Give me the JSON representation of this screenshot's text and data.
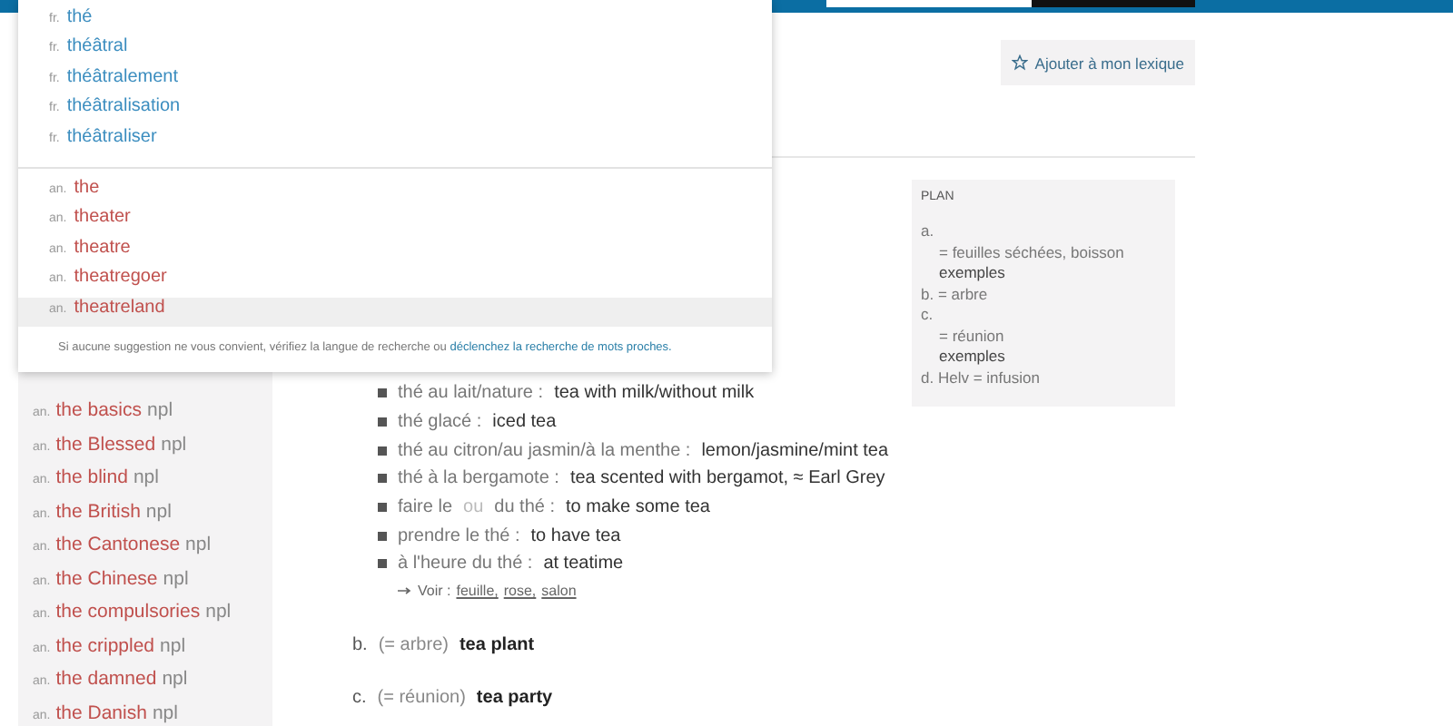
{
  "suggestions": {
    "groups": [
      {
        "kind": "fr",
        "items": [
          {
            "lang": "fr.",
            "word": "thé",
            "selected": false
          },
          {
            "lang": "fr.",
            "word": "théâtral",
            "selected": false
          },
          {
            "lang": "fr.",
            "word": "théâtralement",
            "selected": false
          },
          {
            "lang": "fr.",
            "word": "théâtralisation",
            "selected": false
          },
          {
            "lang": "fr.",
            "word": "théâtraliser",
            "selected": false
          }
        ]
      },
      {
        "kind": "en",
        "items": [
          {
            "lang": "an.",
            "word": "the",
            "selected": false
          },
          {
            "lang": "an.",
            "word": "theater",
            "selected": false
          },
          {
            "lang": "an.",
            "word": "theatre",
            "selected": false
          },
          {
            "lang": "an.",
            "word": "theatregoer",
            "selected": false
          },
          {
            "lang": "an.",
            "word": "theatreland",
            "selected": true
          }
        ]
      }
    ],
    "footer": {
      "text": "Si aucune suggestion ne vous convient, vérifiez la langue de recherche ou",
      "link": "déclenchez la recherche de mots proches."
    }
  },
  "lexicon_button": "Ajouter à mon lexique",
  "sidebar": {
    "items": [
      {
        "lang": "an.",
        "word": "the basics",
        "pos": "npl"
      },
      {
        "lang": "an.",
        "word": "the Blessed",
        "pos": "npl"
      },
      {
        "lang": "an.",
        "word": "the blind",
        "pos": "npl"
      },
      {
        "lang": "an.",
        "word": "the British",
        "pos": "npl"
      },
      {
        "lang": "an.",
        "word": "the Cantonese",
        "pos": "npl"
      },
      {
        "lang": "an.",
        "word": "the Chinese",
        "pos": "npl"
      },
      {
        "lang": "an.",
        "word": "the compulsories",
        "pos": "npl"
      },
      {
        "lang": "an.",
        "word": "the crippled",
        "pos": "npl"
      },
      {
        "lang": "an.",
        "word": "the damned",
        "pos": "npl"
      },
      {
        "lang": "an.",
        "word": "the Danish",
        "pos": "npl"
      }
    ]
  },
  "entry": {
    "examples": [
      {
        "fr": [
          {
            "kind": "phrase",
            "text": "thé au lait/nature :"
          }
        ],
        "en": "tea with milk/without milk"
      },
      {
        "fr": [
          {
            "kind": "phrase",
            "text": "thé glacé :"
          }
        ],
        "en": "iced tea"
      },
      {
        "fr": [
          {
            "kind": "phrase",
            "text": "thé au citron/au jasmin/à la menthe :"
          }
        ],
        "en": "lemon/jasmine/mint tea"
      },
      {
        "fr": [
          {
            "kind": "phrase",
            "text": "thé à la bergamote :"
          }
        ],
        "en": "tea scented with bergamot, ≈ Earl Grey"
      },
      {
        "fr": [
          {
            "kind": "phrase",
            "text": "faire le"
          },
          {
            "kind": "connector",
            "text": "ou"
          },
          {
            "kind": "phrase",
            "text": "du thé :"
          }
        ],
        "en": "to make some tea"
      },
      {
        "fr": [
          {
            "kind": "phrase",
            "text": "prendre le thé :"
          }
        ],
        "en": "to have tea"
      },
      {
        "fr": [
          {
            "kind": "phrase",
            "text": "à l'heure du thé :"
          }
        ],
        "en": "at teatime"
      }
    ],
    "see_also": {
      "label": "Voir :",
      "links": [
        "feuille,",
        "rose,",
        "salon"
      ]
    },
    "senses": [
      {
        "letter": "b.",
        "gloss": "(= arbre)",
        "translation": "tea plant"
      },
      {
        "letter": "c.",
        "gloss": "(= réunion)",
        "translation": "tea party"
      }
    ]
  },
  "plan": {
    "title": "PLAN",
    "items": [
      {
        "text": "a.",
        "kind": "label",
        "children": [
          {
            "text": "= feuilles séchées, boisson",
            "kind": "gloss"
          },
          {
            "text": "exemples",
            "kind": "examples"
          }
        ]
      },
      {
        "text": "b. = arbre",
        "kind": "label"
      },
      {
        "text": "c.",
        "kind": "label",
        "children": [
          {
            "text": "= réunion",
            "kind": "gloss"
          },
          {
            "text": "exemples",
            "kind": "examples"
          }
        ]
      },
      {
        "text": "d. Helv = infusion",
        "kind": "label"
      }
    ]
  }
}
